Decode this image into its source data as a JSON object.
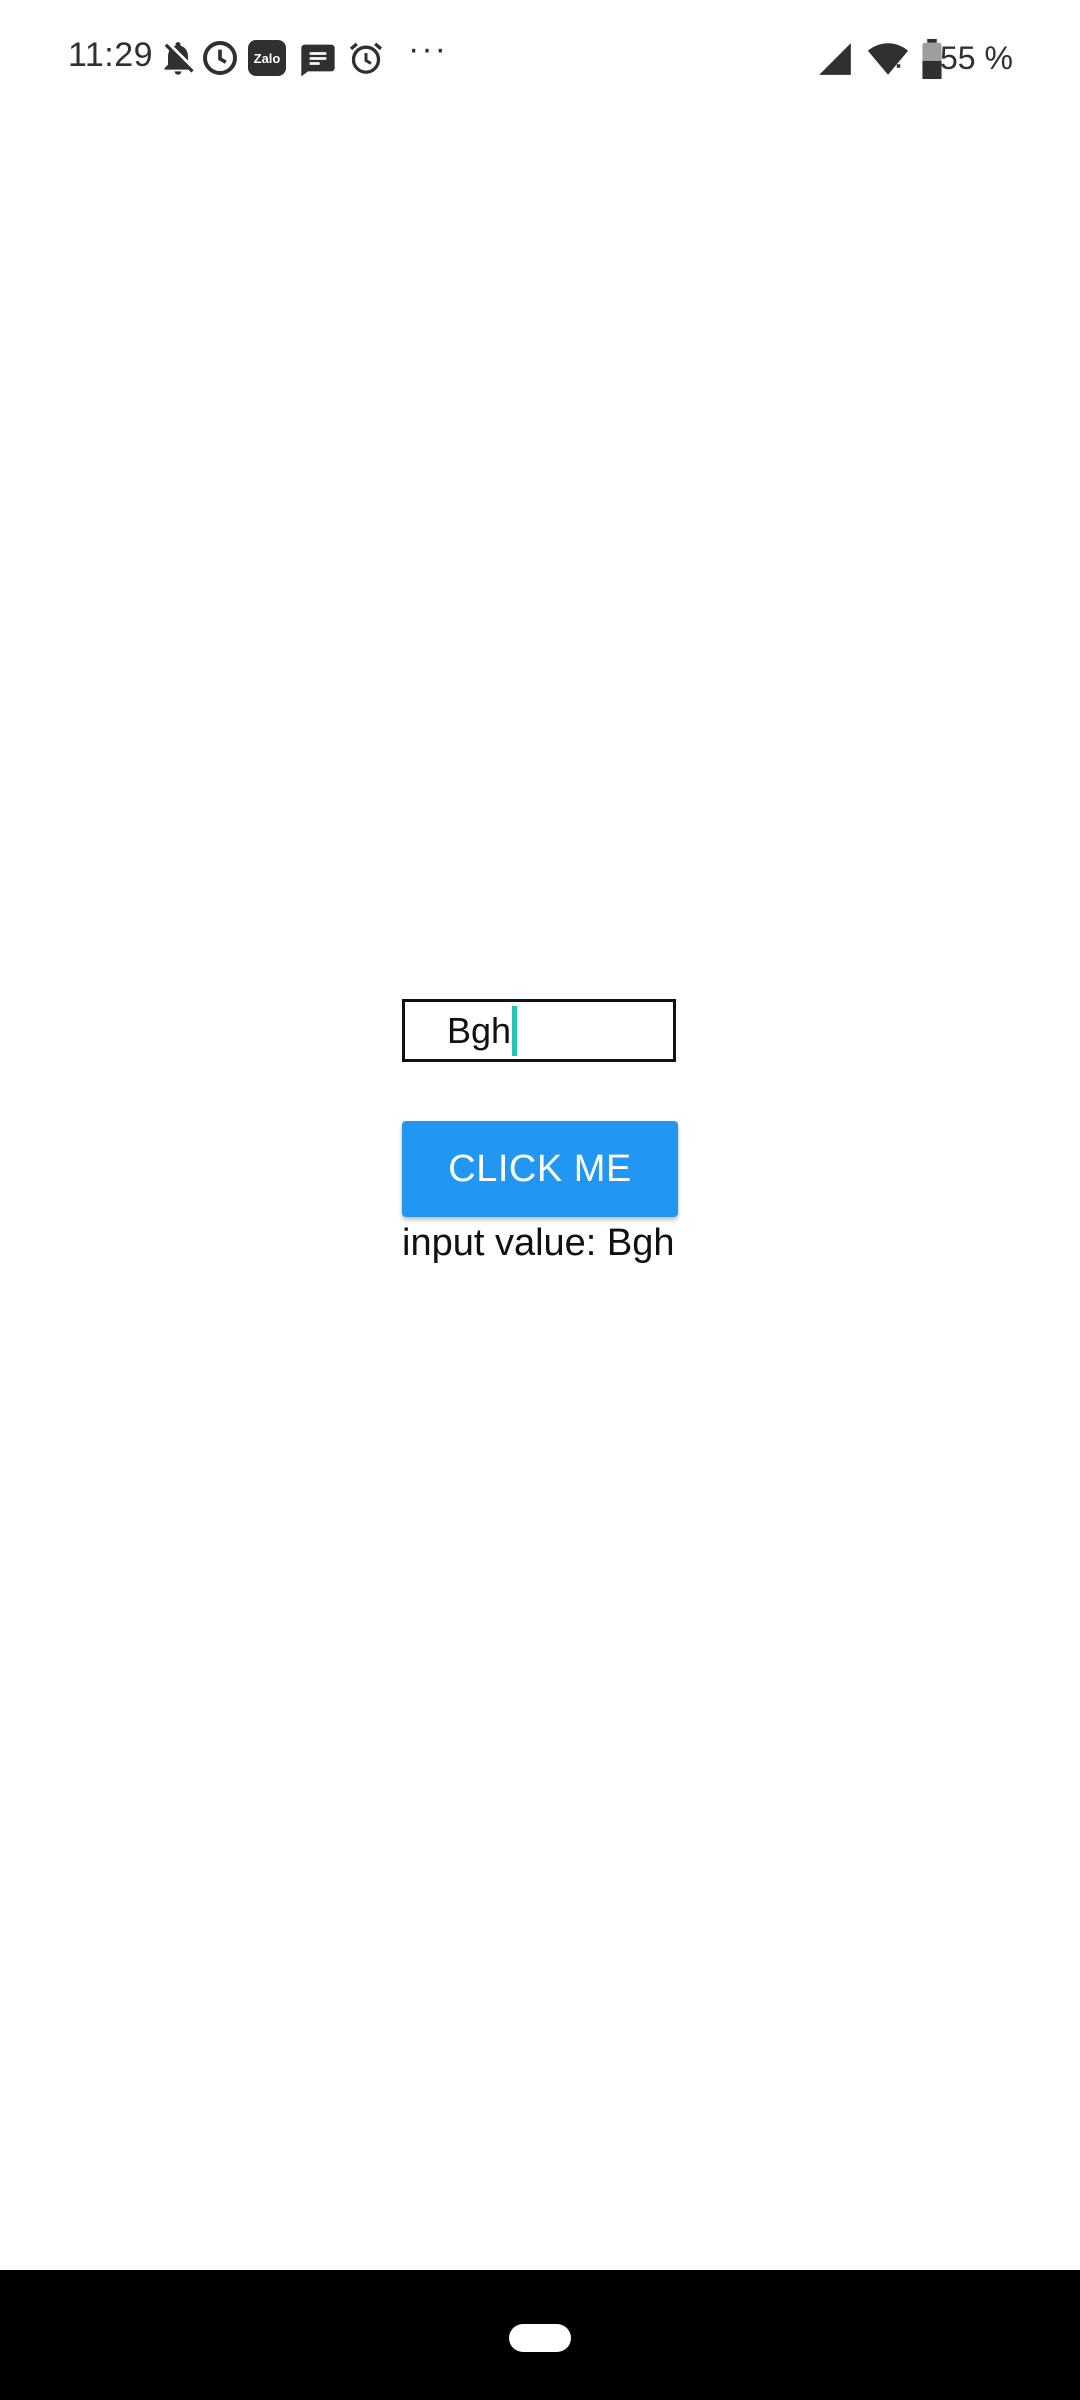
{
  "status_bar": {
    "time": "11:29",
    "zalo_label": "Zalo",
    "more": "···",
    "battery_percent": "55 %",
    "icons": [
      "bell-off-icon",
      "clock-icon",
      "zalo-icon",
      "message-icon",
      "alarm-icon",
      "more-icon",
      "cellular-signal-icon",
      "wifi-icon",
      "battery-icon"
    ]
  },
  "form": {
    "input_value": "Bgh",
    "button_label": "CLICK ME",
    "output_text": "input value: Bgh"
  },
  "colors": {
    "button": "#2196f3",
    "cursor": "#26c6b5",
    "nav_bar": "#000000"
  }
}
